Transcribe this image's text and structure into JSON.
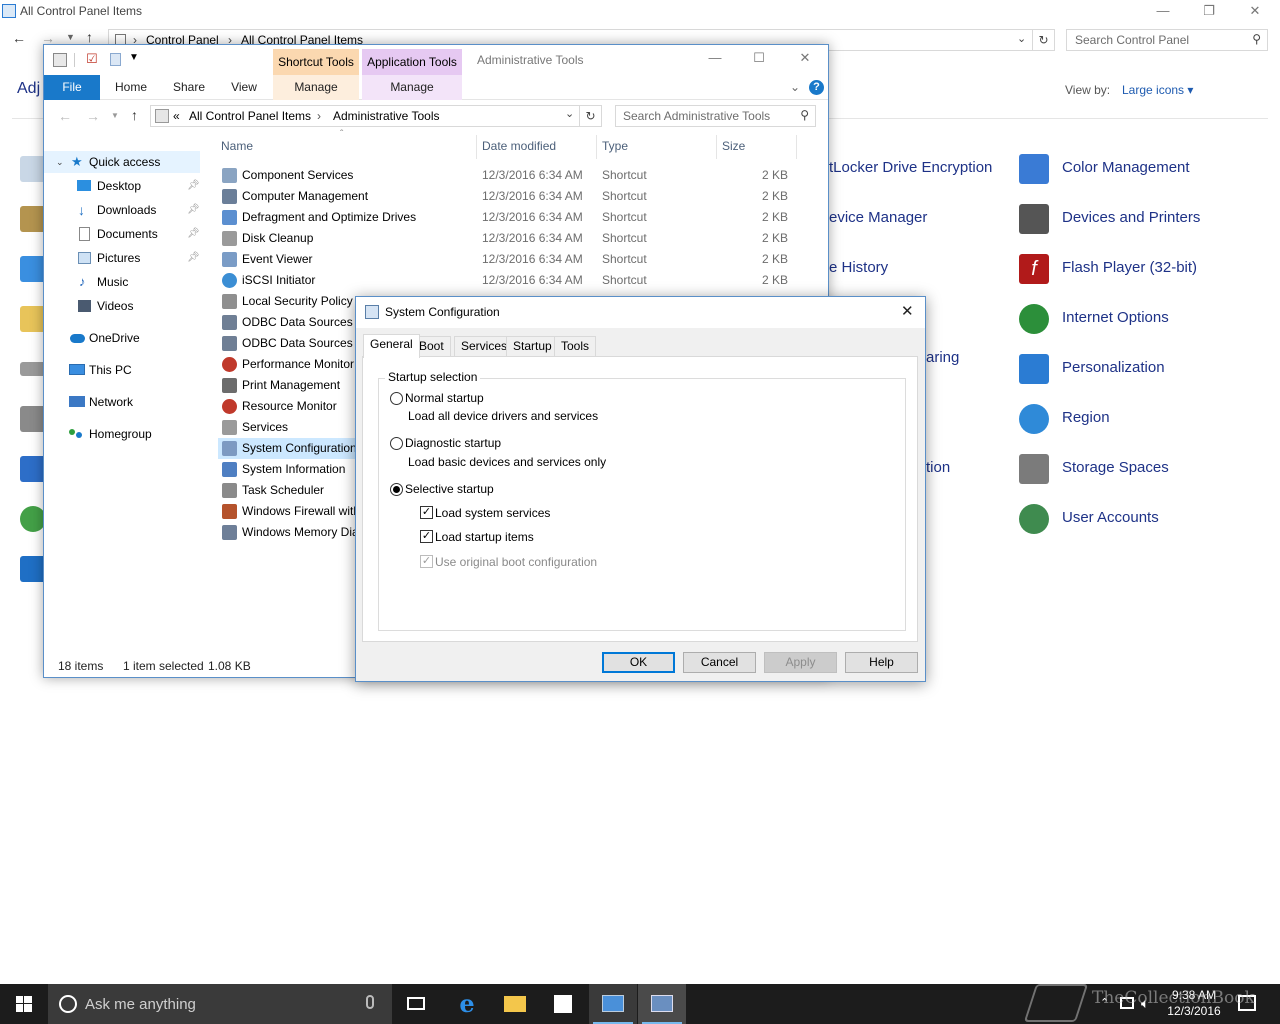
{
  "control_panel": {
    "title": "All Control Panel Items",
    "breadcrumb": [
      "Control Panel",
      "All Control Panel Items"
    ],
    "search_placeholder": "Search Control Panel",
    "heading_partial": "Adj",
    "view_by_label": "View by:",
    "view_by_value": "Large icons ▾",
    "items_partial": [
      "tLocker Drive Encryption",
      "evice Manager",
      "e History",
      "aring",
      "tion"
    ],
    "items_right": [
      {
        "label": "Color Management",
        "icon": "color-management-icon",
        "color": "#3a7bd5"
      },
      {
        "label": "Devices and Printers",
        "icon": "printer-icon",
        "color": "#555555"
      },
      {
        "label": "Flash Player (32-bit)",
        "icon": "flash-icon",
        "color": "#b11a1a"
      },
      {
        "label": "Internet Options",
        "icon": "internet-options-icon",
        "color": "#2c8f3a"
      },
      {
        "label": "Personalization",
        "icon": "personalization-icon",
        "color": "#2b7cd3"
      },
      {
        "label": "Region",
        "icon": "region-icon",
        "color": "#2f8ad8"
      },
      {
        "label": "Storage Spaces",
        "icon": "storage-icon",
        "color": "#7b7b7b"
      },
      {
        "label": "User Accounts",
        "icon": "user-accounts-icon",
        "color": "#3f8b4f"
      }
    ]
  },
  "explorer": {
    "title": "Administrative Tools",
    "context_tabs": [
      {
        "label": "Shortcut Tools",
        "sub": "Manage",
        "color": "#fbd8b0"
      },
      {
        "label": "Application Tools",
        "sub": "Manage",
        "color": "#e6c9f2"
      }
    ],
    "ribbon_tabs": [
      "File",
      "Home",
      "Share",
      "View"
    ],
    "address": [
      "All Control Panel Items",
      "Administrative Tools"
    ],
    "address_prefix": "«",
    "search_placeholder": "Search Administrative Tools",
    "columns": [
      "Name",
      "Date modified",
      "Type",
      "Size"
    ],
    "sidebar": [
      {
        "label": "Quick access",
        "pinned": false
      },
      {
        "label": "Desktop",
        "pinned": true
      },
      {
        "label": "Downloads",
        "pinned": true
      },
      {
        "label": "Documents",
        "pinned": true
      },
      {
        "label": "Pictures",
        "pinned": true
      },
      {
        "label": "Music",
        "pinned": false
      },
      {
        "label": "Videos",
        "pinned": false
      },
      {
        "label": "OneDrive",
        "pinned": false
      },
      {
        "label": "This PC",
        "pinned": false
      },
      {
        "label": "Network",
        "pinned": false
      },
      {
        "label": "Homegroup",
        "pinned": false
      }
    ],
    "files": [
      {
        "name": "Component Services",
        "date": "12/3/2016 6:34 AM",
        "type": "Shortcut",
        "size": "2 KB"
      },
      {
        "name": "Computer Management",
        "date": "12/3/2016 6:34 AM",
        "type": "Shortcut",
        "size": "2 KB"
      },
      {
        "name": "Defragment and Optimize Drives",
        "date": "12/3/2016 6:34 AM",
        "type": "Shortcut",
        "size": "2 KB"
      },
      {
        "name": "Disk Cleanup",
        "date": "12/3/2016 6:34 AM",
        "type": "Shortcut",
        "size": "2 KB"
      },
      {
        "name": "Event Viewer",
        "date": "12/3/2016 6:34 AM",
        "type": "Shortcut",
        "size": "2 KB"
      },
      {
        "name": "iSCSI Initiator",
        "date": "12/3/2016 6:34 AM",
        "type": "Shortcut",
        "size": "2 KB"
      },
      {
        "name": "Local Security Policy",
        "date": "",
        "type": "",
        "size": ""
      },
      {
        "name": "ODBC Data Sources (3",
        "date": "",
        "type": "",
        "size": ""
      },
      {
        "name": "ODBC Data Sources (6",
        "date": "",
        "type": "",
        "size": ""
      },
      {
        "name": "Performance Monitor",
        "date": "",
        "type": "",
        "size": ""
      },
      {
        "name": "Print Management",
        "date": "",
        "type": "",
        "size": ""
      },
      {
        "name": "Resource Monitor",
        "date": "",
        "type": "",
        "size": ""
      },
      {
        "name": "Services",
        "date": "",
        "type": "",
        "size": ""
      },
      {
        "name": "System Configuration",
        "date": "",
        "type": "",
        "size": ""
      },
      {
        "name": "System Information",
        "date": "",
        "type": "",
        "size": ""
      },
      {
        "name": "Task Scheduler",
        "date": "",
        "type": "",
        "size": ""
      },
      {
        "name": "Windows Firewall with",
        "date": "",
        "type": "",
        "size": ""
      },
      {
        "name": "Windows Memory Dia",
        "date": "",
        "type": "",
        "size": ""
      }
    ],
    "selected_index": 13,
    "status_count": "18 items",
    "status_selection": "1 item selected",
    "status_size": "1.08 KB"
  },
  "dialog": {
    "title": "System Configuration",
    "tabs": [
      "General",
      "Boot",
      "Services",
      "Startup",
      "Tools"
    ],
    "active_tab": "General",
    "group_label": "Startup selection",
    "options": [
      {
        "label": "Normal startup",
        "desc": "Load all device drivers and services",
        "selected": false
      },
      {
        "label": "Diagnostic startup",
        "desc": "Load basic devices and services only",
        "selected": false
      },
      {
        "label": "Selective startup",
        "desc": "",
        "selected": true
      }
    ],
    "checkboxes": [
      {
        "label": "Load system services",
        "checked": true,
        "disabled": false
      },
      {
        "label": "Load startup items",
        "checked": true,
        "disabled": false
      },
      {
        "label": "Use original boot configuration",
        "checked": true,
        "disabled": true
      }
    ],
    "buttons": [
      "OK",
      "Cancel",
      "Apply",
      "Help"
    ]
  },
  "taskbar": {
    "search_placeholder": "Ask me anything",
    "time": "9:38 AM",
    "date": "12/3/2016",
    "watermark": "TheCollectionBook"
  }
}
